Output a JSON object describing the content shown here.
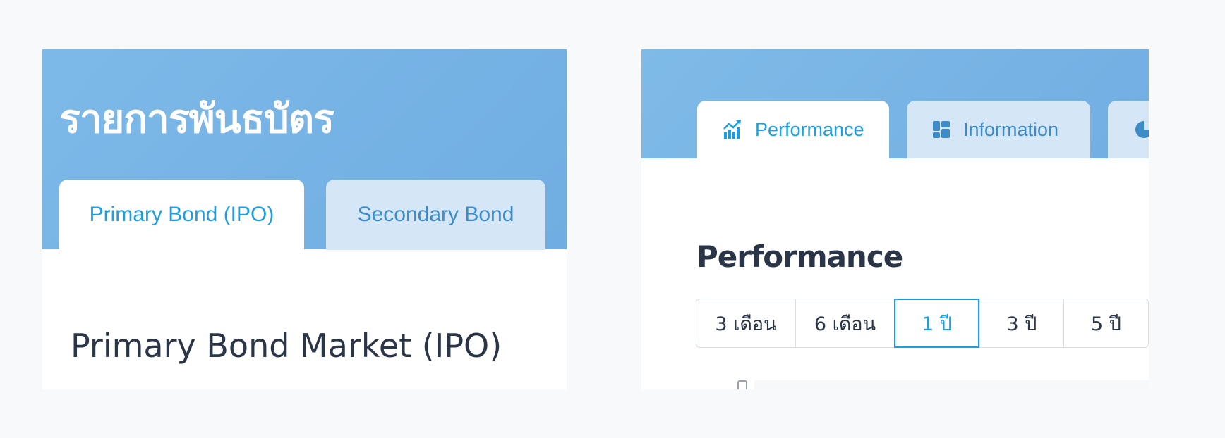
{
  "left_panel": {
    "title": "รายการพันธบัตร",
    "tabs": [
      {
        "label": "Primary Bond (IPO)",
        "active": true
      },
      {
        "label": "Secondary Bond",
        "active": false
      }
    ],
    "heading": "Primary Bond Market (IPO)"
  },
  "right_panel": {
    "tabs": [
      {
        "label": "Performance",
        "icon": "chart-growth-icon",
        "active": true
      },
      {
        "label": "Information",
        "icon": "dashboard-grid-icon",
        "active": false
      },
      {
        "label": "",
        "icon": "pie-chart-icon",
        "active": false
      }
    ],
    "heading": "Performance",
    "periods": [
      {
        "label": "3 เดือน",
        "selected": false
      },
      {
        "label": "6 เดือน",
        "selected": false
      },
      {
        "label": "1 ปี",
        "selected": true
      },
      {
        "label": "3 ปี",
        "selected": false
      },
      {
        "label": "5 ปี",
        "selected": false
      }
    ]
  },
  "colors": {
    "accent": "#1a9fe0",
    "hero_blue": "#75b2e4",
    "inactive_tab": "#d5e7f7",
    "heading_text": "#2b3548"
  }
}
